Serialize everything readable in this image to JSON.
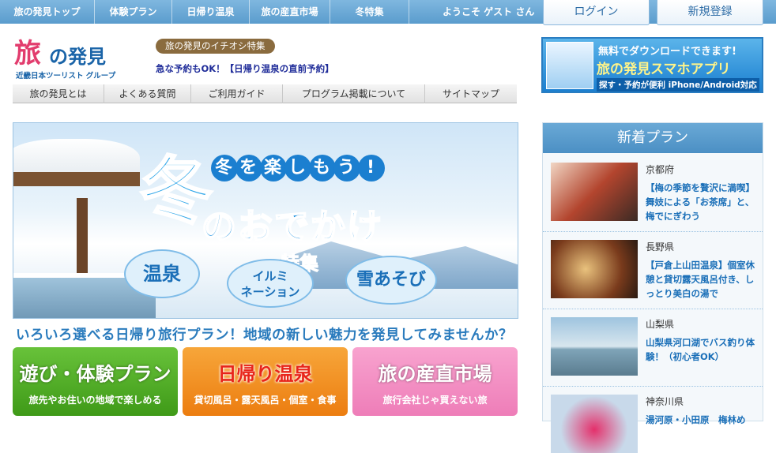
{
  "topnav": {
    "items": [
      {
        "label": "旅の発見トップ"
      },
      {
        "label": "体験プラン"
      },
      {
        "label": "日帰り温泉"
      },
      {
        "label": "旅の産直市場"
      },
      {
        "label": "冬特集"
      }
    ],
    "welcome": "ようこそ ゲスト さん",
    "login_label": "ログイン",
    "register_label": "新規登録"
  },
  "logo": {
    "mark": "旅",
    "text": "の発見",
    "company": "近畿日本ツーリスト グループ"
  },
  "pickup": {
    "badge": "旅の発見のイチオシ特集",
    "link": "急な予約もOK！【日帰り温泉の直前予約】"
  },
  "app_banner": {
    "line1": "無料でダウンロードできます!",
    "line2": "旅の発見スマホアプリ",
    "line3": "探す・予約が便利 iPhone/Android対応"
  },
  "subnav": {
    "items": [
      {
        "label": "旅の発見とは"
      },
      {
        "label": "よくある質問"
      },
      {
        "label": "ご利用ガイド"
      },
      {
        "label": "プログラム掲載について"
      },
      {
        "label": "サイトマップ"
      }
    ]
  },
  "hero": {
    "tanoshi": [
      "冬",
      "を",
      "楽",
      "し",
      "も",
      "う",
      "!"
    ],
    "fuyu": "冬",
    "odekake": "のおでかけ",
    "tokushu": "特集",
    "bubbles": [
      "温泉",
      "イルミ\nネーション",
      "雪あそび"
    ]
  },
  "tagline": "いろいろ選べる日帰り旅行プラン！地域の新しい魅力を発見してみませんか？",
  "categories": [
    {
      "title": "遊び・体験プラン",
      "sub": "旅先やお住いの地域で楽しめる",
      "color": "#4aa51f"
    },
    {
      "title": "日帰り温泉",
      "sub": "貸切風呂・露天風呂・個室・食事",
      "color": "#f08a1a"
    },
    {
      "title": "旅の産直市場",
      "sub": "旅行会社じゃ買えない旅",
      "color": "#f08ac0"
    }
  ],
  "new_plans": {
    "header": "新着プラン",
    "items": [
      {
        "pref": "京都府",
        "title": "【梅の季節を贅沢に満喫】舞妓による「お茶席」と、梅でにぎわう"
      },
      {
        "pref": "長野県",
        "title": "【戸倉上山田温泉】個室休憩と貸切露天風呂付き、しっとり美白の湯で"
      },
      {
        "pref": "山梨県",
        "title": "山梨県河口湖でバス釣り体験！（初心者OK）"
      },
      {
        "pref": "神奈川県",
        "title": "湯河原・小田原　梅林め"
      }
    ]
  }
}
